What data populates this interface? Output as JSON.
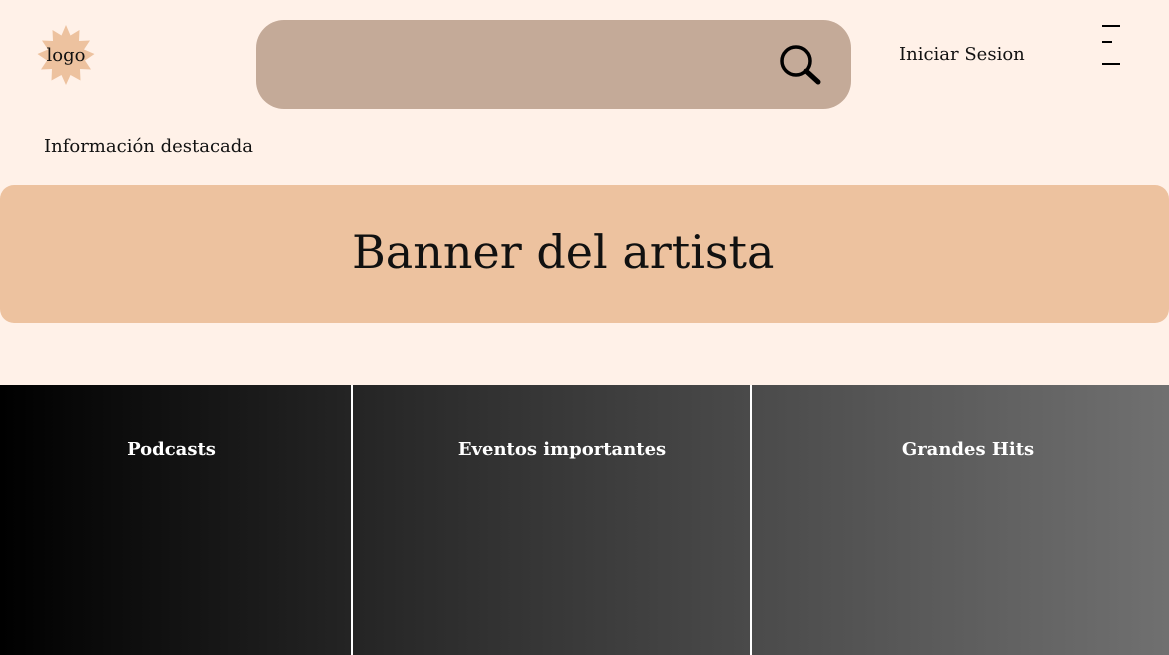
{
  "header": {
    "logo_text": "logo",
    "search": {
      "value": "",
      "placeholder": "",
      "icon": "search-icon"
    },
    "login_label": "Iniciar Sesion",
    "menu_icon": "menu-icon"
  },
  "featured": {
    "label": "Información destacada"
  },
  "banner": {
    "title": "Banner del artista"
  },
  "sections": [
    {
      "label": "Podcasts"
    },
    {
      "label": "Eventos importantes"
    },
    {
      "label": "Grandes Hits"
    }
  ],
  "colors": {
    "page_background": "#fff1e8",
    "search_background": "#c4aa98",
    "banner_background": "#edc29f",
    "logo_badge": "#edc29f",
    "section_gradient_start": "#000000",
    "section_gradient_end": "#707070",
    "section_text": "#ffffff"
  }
}
